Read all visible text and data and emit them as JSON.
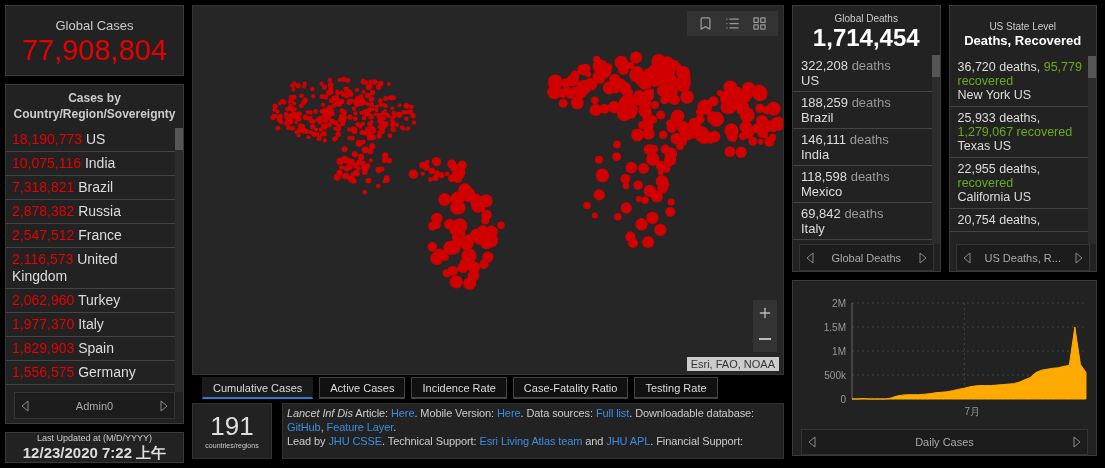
{
  "global_cases": {
    "title": "Global Cases",
    "value": "77,908,804"
  },
  "cases_list": {
    "title": "Cases by Country/Region/Sovereignty",
    "footer": "Admin0",
    "rows": [
      {
        "count": "18,190,773",
        "place": "US"
      },
      {
        "count": "10,075,116",
        "place": "India"
      },
      {
        "count": "7,318,821",
        "place": "Brazil"
      },
      {
        "count": "2,878,382",
        "place": "Russia"
      },
      {
        "count": "2,547,512",
        "place": "France"
      },
      {
        "count": "2,116,573",
        "place": "United Kingdom"
      },
      {
        "count": "2,062,960",
        "place": "Turkey"
      },
      {
        "count": "1,977,370",
        "place": "Italy"
      },
      {
        "count": "1,829,903",
        "place": "Spain"
      },
      {
        "count": "1,556,575",
        "place": "Germany"
      }
    ]
  },
  "last_updated": {
    "label": "Last Updated at (M/D/YYYY)",
    "value": "12/23/2020 7:22 上午"
  },
  "map": {
    "attribution": "Esri, FAO, NOAA"
  },
  "tabs": [
    {
      "label": "Cumulative Cases",
      "selected": true
    },
    {
      "label": "Active Cases",
      "selected": false
    },
    {
      "label": "Incidence Rate",
      "selected": false
    },
    {
      "label": "Case-Fatality Ratio",
      "selected": false
    },
    {
      "label": "Testing Rate",
      "selected": false
    }
  ],
  "countries": {
    "value": "191",
    "label": "countries/regions"
  },
  "credits": [
    [
      {
        "kind": "italic",
        "text": "Lancet Inf Dis"
      },
      {
        "kind": "plain",
        "text": " Article: "
      },
      {
        "kind": "link",
        "text": "Here"
      },
      {
        "kind": "plain",
        "text": ". Mobile Version: "
      },
      {
        "kind": "link",
        "text": "Here"
      },
      {
        "kind": "plain",
        "text": ". Data sources: "
      },
      {
        "kind": "link",
        "text": "Full list"
      },
      {
        "kind": "plain",
        "text": ". Downloadable database: "
      },
      {
        "kind": "link",
        "text": "GitHub"
      },
      {
        "kind": "plain",
        "text": ", "
      },
      {
        "kind": "link",
        "text": "Feature Layer"
      },
      {
        "kind": "plain",
        "text": "."
      }
    ],
    [
      {
        "kind": "plain",
        "text": "Lead by "
      },
      {
        "kind": "link",
        "text": "JHU CSSE"
      },
      {
        "kind": "plain",
        "text": ". Technical Support: "
      },
      {
        "kind": "link",
        "text": "Esri Living Atlas team"
      },
      {
        "kind": "plain",
        "text": " and "
      },
      {
        "kind": "link",
        "text": "JHU APL"
      },
      {
        "kind": "plain",
        "text": ". Financial Support:"
      }
    ]
  ],
  "global_deaths": {
    "title": "Global Deaths",
    "value": "1,714,454",
    "footer": "Global Deaths",
    "rows": [
      {
        "count": "322,208",
        "unit": "deaths",
        "place": "US"
      },
      {
        "count": "188,259",
        "unit": "deaths",
        "place": "Brazil"
      },
      {
        "count": "146,111",
        "unit": "deaths",
        "place": "India"
      },
      {
        "count": "118,598",
        "unit": "deaths",
        "place": "Mexico"
      },
      {
        "count": "69,842",
        "unit": "deaths",
        "place": "Italy"
      }
    ]
  },
  "us_states": {
    "subtitle": "US State Level",
    "title": "Deaths, Recovered",
    "footer": "US Deaths, R...",
    "rows": [
      {
        "deaths": "36,720 deaths,",
        "recovered": "95,779 recovered",
        "place": "New York US"
      },
      {
        "deaths": "25,933 deaths,",
        "recovered": "1,279,067 recovered",
        "place": "Texas US"
      },
      {
        "deaths": "22,955 deaths,",
        "recovered": "recovered",
        "place": "California US"
      },
      {
        "deaths": "20,754 deaths,"
      }
    ]
  },
  "daily_cases": {
    "footer": "Daily Cases",
    "chart_data": {
      "type": "area",
      "grid": true,
      "series": [
        {
          "color": "#ffaa00",
          "values": [
            0,
            0,
            10000,
            0,
            0,
            0,
            0,
            20000,
            60000,
            80000,
            90000,
            90000,
            90000,
            100000,
            110000,
            130000,
            140000,
            150000,
            170000,
            200000,
            220000,
            250000,
            270000,
            280000,
            280000,
            280000,
            290000,
            300000,
            310000,
            320000,
            350000,
            400000,
            450000,
            550000,
            600000,
            620000,
            640000,
            650000,
            680000,
            700000,
            1500000,
            720000,
            550000
          ]
        }
      ],
      "ylim": [
        0,
        2000000
      ],
      "yticks": [
        {
          "value": 0,
          "label": "0"
        },
        {
          "value": 500000,
          "label": "500k"
        },
        {
          "value": 1000000,
          "label": "1M"
        },
        {
          "value": 1500000,
          "label": "1.5M"
        },
        {
          "value": 2000000,
          "label": "2M"
        }
      ],
      "annotations": [
        "7月"
      ]
    }
  }
}
